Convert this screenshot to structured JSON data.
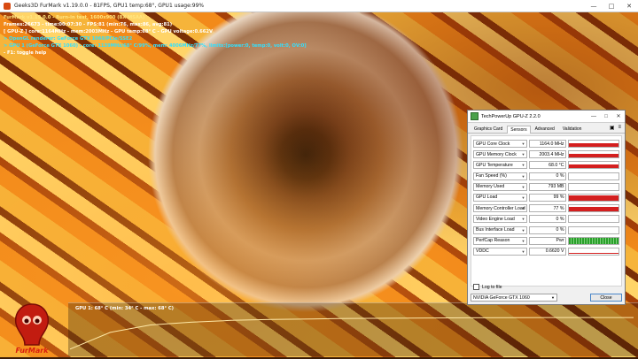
{
  "furmark": {
    "window_title": "Geeks3D FurMark v1.19.0.0 - 81FPS, GPU1 temp:68°, GPU1 usage:99%",
    "overlay": {
      "line1": "FurMark v1.19.0.0 - Burn-in test, 1600x900 (8X MSAA)",
      "line2": "Frames:26673 - time:00:07:30 - FPS:81 (min:76, max:86, avg:81)",
      "line3": "[ GPU-Z ] core:1164MHz - mem:2003MHz - GPU temp:68° C - GPU voltage:0.662V",
      "line4": "> OpenGL renderer: GeForce GTX 1060/PCIe/SSE2",
      "line5": "> GPU 1 (GeForce GTX 1060) - core: 1139MHz/68° C/99%, mem: 4006MHz/77%, limits:[power:0, temp:0, volt:0, OV:0]",
      "line6": "- F1: toggle help"
    },
    "temp_graph_label": "GPU 1: 68° C (min: 34° C - max: 68° C)",
    "temp_series": [
      34,
      52,
      60,
      63,
      65,
      66,
      66.5,
      67,
      67.2,
      67.5,
      67.7,
      67.9,
      68,
      68,
      68
    ],
    "logo_text": "FurMark"
  },
  "gpuz": {
    "title": "TechPowerUp GPU-Z 2.2.0",
    "tabs": [
      "Graphics Card",
      "Sensors",
      "Advanced",
      "Validation"
    ],
    "active_tab": "Sensors",
    "sensors": [
      {
        "name": "GPU Core Clock",
        "value": "1164.0 MHz",
        "graph": "bar",
        "level": 0.6
      },
      {
        "name": "GPU Memory Clock",
        "value": "2003.4 MHz",
        "graph": "bar",
        "level": 0.6
      },
      {
        "name": "GPU Temperature",
        "value": "68.0 °C",
        "graph": "bar",
        "level": 0.6
      },
      {
        "name": "Fan Speed (%)",
        "value": "0 %",
        "graph": "none",
        "level": 0
      },
      {
        "name": "Memory Used",
        "value": "793 MB",
        "graph": "none",
        "level": 0
      },
      {
        "name": "GPU Load",
        "value": "99 %",
        "graph": "bar",
        "level": 0.9
      },
      {
        "name": "Memory Controller Load",
        "value": "77 %",
        "graph": "bar",
        "level": 0.7
      },
      {
        "name": "Video Engine Load",
        "value": "0 %",
        "graph": "none",
        "level": 0
      },
      {
        "name": "Bus Interface Load",
        "value": "0 %",
        "graph": "none",
        "level": 0
      },
      {
        "name": "PerfCap Reason",
        "value": "Pwr",
        "graph": "perf",
        "level": 1
      },
      {
        "name": "VDDC",
        "value": "0.6620 V",
        "graph": "line",
        "level": 0.1
      }
    ],
    "log_label": "Log to file",
    "device": "NVIDIA GeForce GTX 1060",
    "close_label": "Close"
  }
}
